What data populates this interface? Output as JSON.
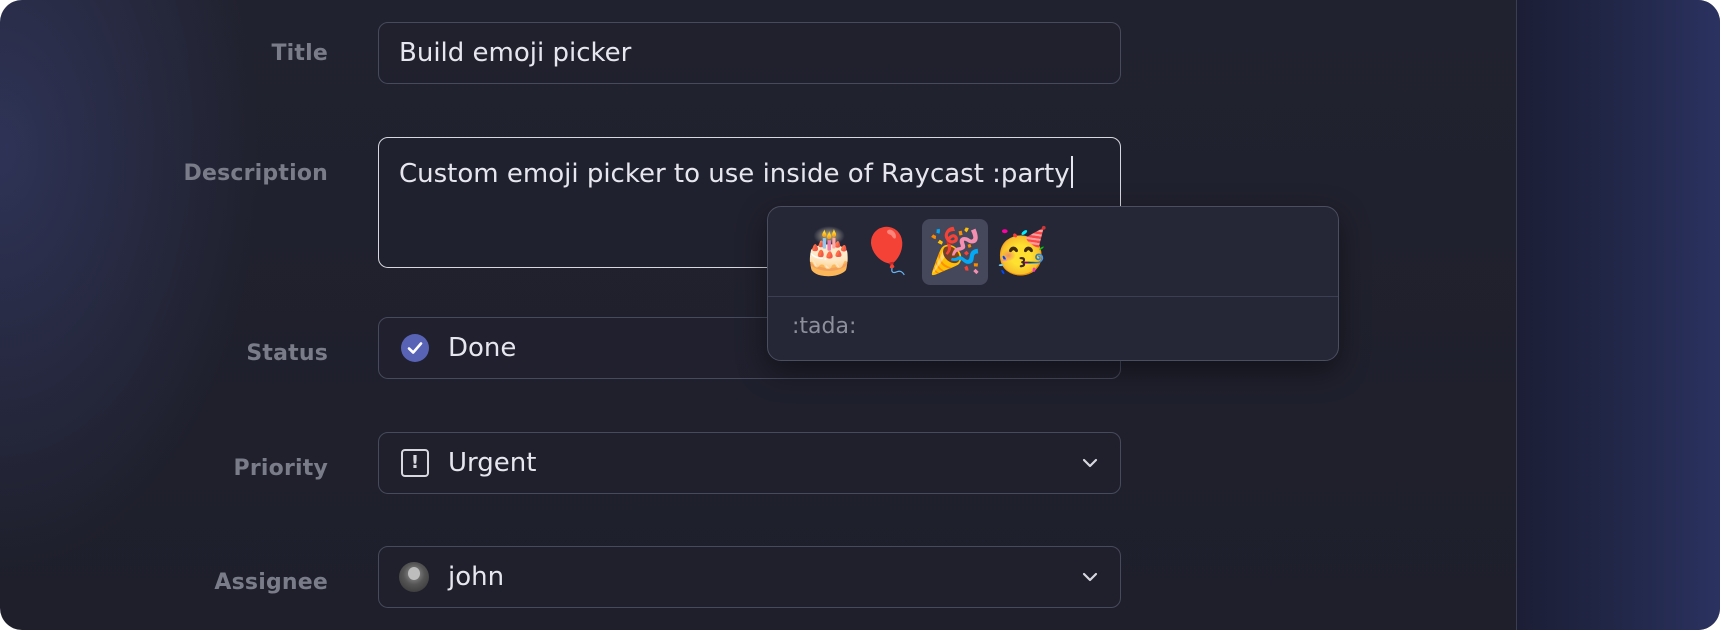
{
  "form": {
    "title": {
      "label": "Title",
      "value": "Build emoji picker"
    },
    "description": {
      "label": "Description",
      "value": "Custom emoji picker to use inside of Raycast :party"
    },
    "status": {
      "label": "Status",
      "value": "Done",
      "icon": "check-circle-icon",
      "icon_color": "#5863b6"
    },
    "priority": {
      "label": "Priority",
      "value": "Urgent",
      "icon": "exclamation-square-icon"
    },
    "assignee": {
      "label": "Assignee",
      "value": "john",
      "icon": "avatar"
    }
  },
  "emoji_picker": {
    "emojis": [
      {
        "glyph": "🎂",
        "name": "birthday-cake"
      },
      {
        "glyph": "🎈",
        "name": "balloon"
      },
      {
        "glyph": "🎉",
        "name": "party-popper"
      },
      {
        "glyph": "🥳",
        "name": "partying-face"
      }
    ],
    "selected_index": 2,
    "selected_shortcode": ":tada:"
  },
  "colors": {
    "background": "#1f202c",
    "field_border": "#474a5c",
    "focused_border": "#d7d8df",
    "accent": "#5863b6"
  }
}
